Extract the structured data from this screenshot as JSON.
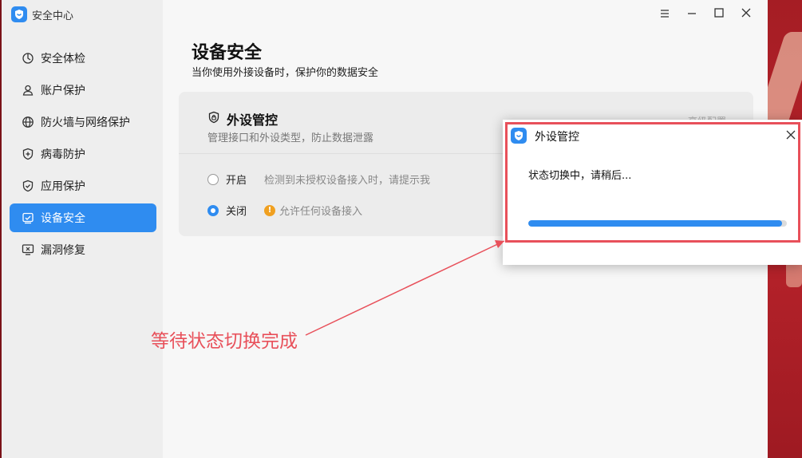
{
  "app": {
    "title": "安全中心"
  },
  "sidebar": {
    "items": [
      {
        "label": "安全体检",
        "icon": "refresh-circle-icon",
        "active": false
      },
      {
        "label": "账户保护",
        "icon": "user-icon",
        "active": false
      },
      {
        "label": "防火墙与网络保护",
        "icon": "globe-icon",
        "active": false
      },
      {
        "label": "病毒防护",
        "icon": "shield-plus-icon",
        "active": false
      },
      {
        "label": "应用保护",
        "icon": "shield-check-icon",
        "active": false
      },
      {
        "label": "设备安全",
        "icon": "device-icon",
        "active": true
      },
      {
        "label": "漏洞修复",
        "icon": "monitor-bug-icon",
        "active": false
      }
    ]
  },
  "main": {
    "title": "设备安全",
    "subtitle": "当你使用外接设备时，保护你的数据安全",
    "card": {
      "title": "外设管控",
      "description": "管理接口和外设类型，防止数据泄露",
      "link": "高级配置",
      "options": [
        {
          "label": "开启",
          "description": "检测到未授权设备接入时，请提示我",
          "checked": false
        },
        {
          "label": "关闭",
          "description": "允许任何设备接入",
          "checked": true,
          "warn": true
        }
      ]
    }
  },
  "dialog": {
    "title": "外设管控",
    "message": "状态切换中，请稍后...",
    "progress": 0.98
  },
  "annotation": {
    "text": "等待状态切换完成"
  },
  "colors": {
    "accent": "#2f8cf0",
    "highlight": "#e8505a",
    "warning": "#f0a020"
  }
}
